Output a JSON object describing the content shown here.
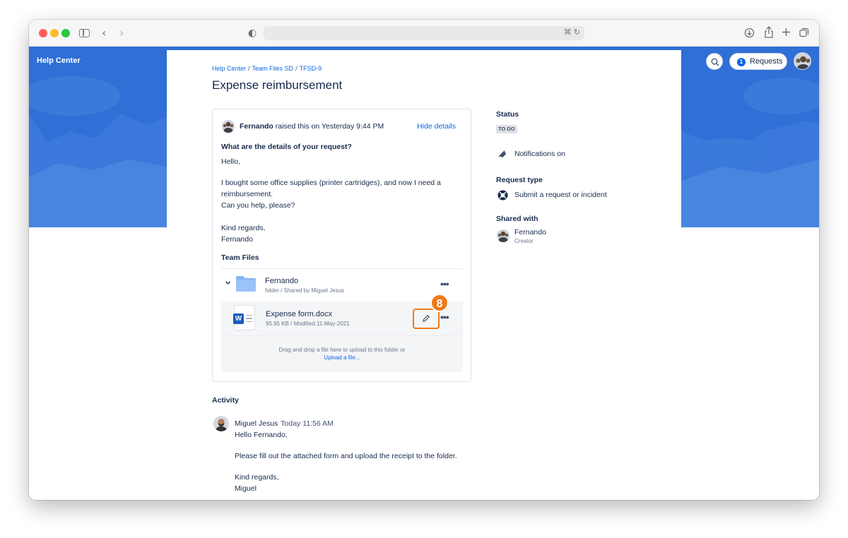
{
  "browser": {
    "address_icons": "⌘ ↻"
  },
  "header": {
    "brand": "Help Center",
    "requests_count": "1",
    "requests_label": "Requests"
  },
  "breadcrumb": [
    "Help Center",
    "Team Files SD",
    "TFSD-9"
  ],
  "page_title": "Expense reimbursement",
  "request": {
    "author": "Fernando",
    "raised_text": " raised this on Yesterday 9:44 PM",
    "hide_details": "Hide details",
    "question": "What are the details of your request?",
    "message_lines": [
      "Hello,",
      "I bought some office supplies (printer cartridges), and now I need a",
      "reimbursement.",
      "Can you help, please?",
      "Kind regards,",
      "Fernando"
    ]
  },
  "team_files": {
    "title": "Team Files",
    "folder_name": "Fernando",
    "folder_meta": "folder / Shared by Miguel Jesus",
    "file_name": "Expense form.docx",
    "file_meta": "95.95 KB / Modified 11-May-2021",
    "file_type_letter": "W",
    "more": "•••",
    "step_badge": "8",
    "drop_text": "Drag and drop a file here to upload to this folder or",
    "upload_link": "Upload a file..."
  },
  "sidebar": {
    "status_label": "Status",
    "status_value": "TO DO",
    "notifications": "Notifications on",
    "request_type_label": "Request type",
    "request_type_value": "Submit a request or incident",
    "shared_with_label": "Shared with",
    "shared_name": "Fernando",
    "shared_role": "Creator"
  },
  "activity": {
    "title": "Activity",
    "author": "Miguel Jesus",
    "time": "Today 11:56 AM",
    "lines": [
      "Hello Fernando,",
      "Please fill out the attached form and upload the receipt to the folder.",
      "Kind regards,",
      "Miguel"
    ]
  },
  "colors": {
    "banner": "#2f6fd6",
    "link": "#0c66e4",
    "highlight": "#f07a1a",
    "text": "#172b4d"
  }
}
